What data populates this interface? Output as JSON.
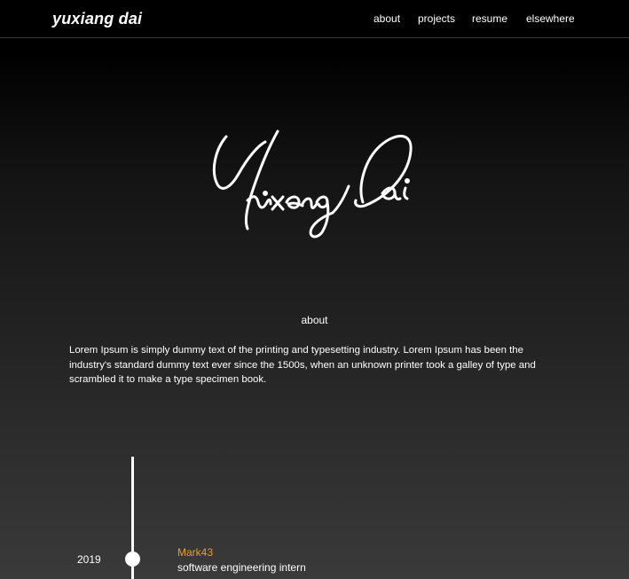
{
  "header": {
    "brand": "yuxiang dai",
    "nav": {
      "about": "about",
      "projects": "projects",
      "resume": "resume",
      "elsewhere": "elsewhere"
    }
  },
  "hero": {
    "signature_text": "Yuxiang Dai"
  },
  "about": {
    "heading": "about",
    "text": "Lorem Ipsum is simply dummy text of the printing and typesetting industry. Lorem Ipsum has been the industry's standard dummy text ever since the 1500s, when an unknown printer took a galley of type and scrambled it to make a type specimen book."
  },
  "timeline": {
    "entries": [
      {
        "year": "2019",
        "company": "Mark43",
        "role": "software engineering intern"
      }
    ]
  },
  "colors": {
    "accent": "#e8a21a",
    "background_top": "#000000",
    "background_bottom": "#3a3a3a",
    "text": "#ffffff"
  }
}
